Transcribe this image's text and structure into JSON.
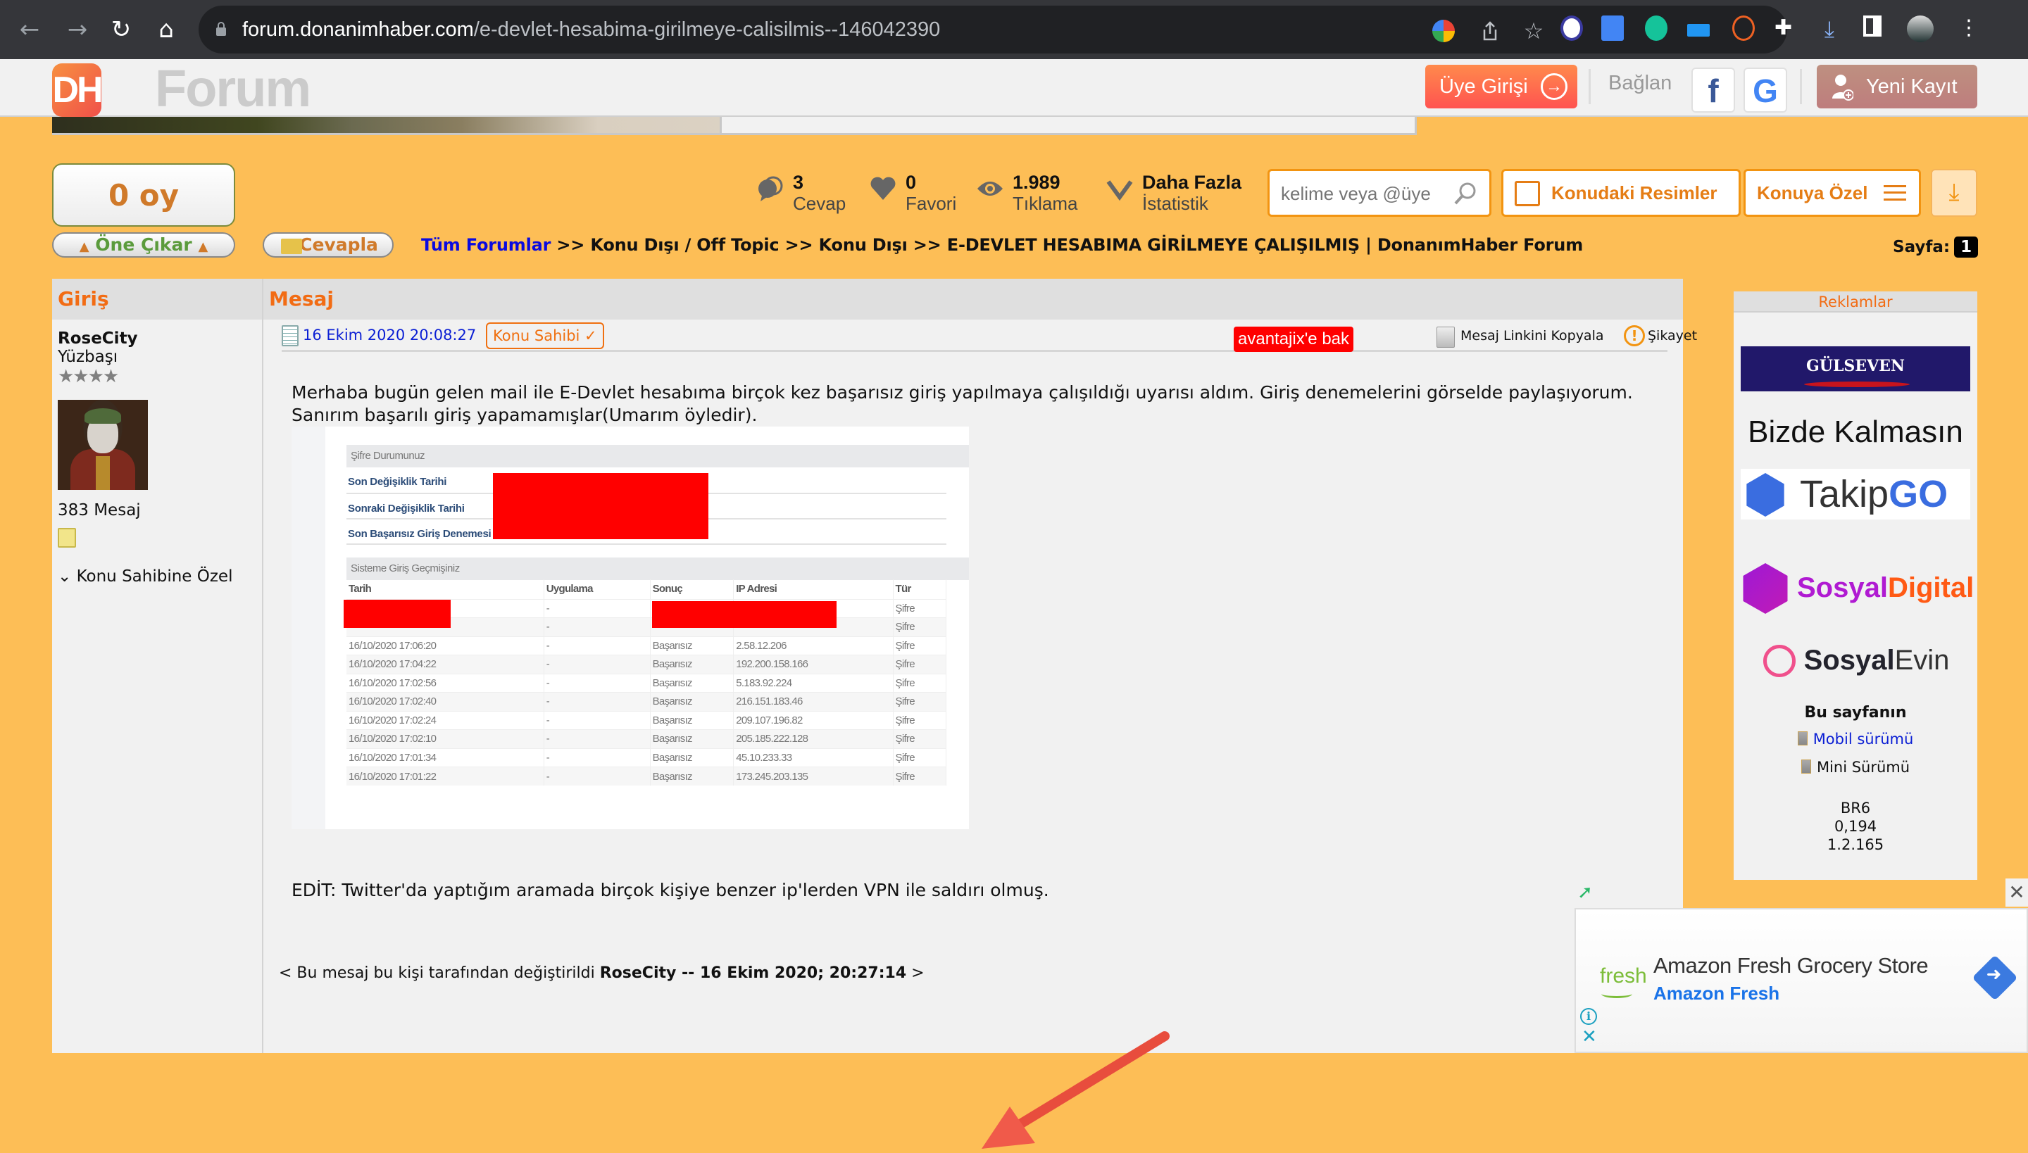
{
  "browser": {
    "url_host": "forum.donanimhaber.com",
    "url_path": "/e-devlet-hesabima-girilmeye-calisilmis--146042390",
    "nav": {
      "back": "←",
      "forward": "→",
      "reload": "↻",
      "home": "⌂"
    },
    "toolbar_icons": [
      "google-icon",
      "share-icon",
      "bookmark-star-icon",
      "adblock-icon",
      "google-translate-icon",
      "grammarly-icon",
      "screen-icon",
      "bitly-icon",
      "extensions-puzzle-icon",
      "download-icon",
      "sidepanel-icon",
      "profile-avatar",
      "menu-kebab-icon"
    ]
  },
  "site": {
    "logo_dh": "DH",
    "logo_forum": "Forum",
    "login_label": "Üye Girişi",
    "connect_label": "Bağlan",
    "facebook": "f",
    "google": "G",
    "register_label": "Yeni Kayıt"
  },
  "toolbar": {
    "vote": "0 oy",
    "promote": "Öne Çıkar",
    "reply": "Cevapla",
    "stats": [
      {
        "value": "3",
        "label": "Cevap",
        "icon": "chat-bubbles-icon"
      },
      {
        "value": "0",
        "label": "Favori",
        "icon": "heart-icon"
      },
      {
        "value": "1.989",
        "label": "Tıklama",
        "icon": "eye-icon"
      },
      {
        "value": "Daha Fazla",
        "label": "İstatistik",
        "icon": "chevron-down-icon"
      }
    ],
    "search_placeholder": "kelime veya @üye",
    "images_button": "Konudaki Resimler",
    "topic_special_button": "Konuya Özel"
  },
  "breadcrumb": {
    "root": "Tüm Forumlar",
    "rest": " >> Konu Dışı / Off Topic >> Konu Dışı >> E-DEVLET HESABIMA GİRİLMEYE ÇALIŞILMIŞ | DonanımHaber Forum"
  },
  "pagination": {
    "label": "Sayfa:",
    "current": "1"
  },
  "post": {
    "col_user": "Giriş",
    "col_message": "Mesaj",
    "user": {
      "name": "RoseCity",
      "rank": "Yüzbaşı",
      "stars": "★★★★",
      "posts": "383 Mesaj",
      "owner_special": "Konu Sahibine Özel"
    },
    "date": "16 Ekim 2020 20:08:27",
    "owner_badge": "Konu Sahibi ✓",
    "avantajix": "avantajix'e bak",
    "copy_link": "Mesaj Linkini Kopyala",
    "report": "Şikayet",
    "body": "Merhaba bugün gelen mail ile E-Devlet hesabıma birçok kez başarısız giriş yapılmaya çalışıldığı uyarısı aldım. Giriş denemelerini görselde paylaşıyorum. Sanırım başarılı giriş yapamamışlar(Umarım öyledir).",
    "edit_text": "EDİT: Twitter'da yaptığım aramada birçok kişiye benzer ip'lerden VPN ile saldırı olmuş.",
    "edited_prefix": "< Bu mesaj bu kişi tarafından değiştirildi ",
    "edited_user": "RoseCity",
    "edited_date": " -- 16 Ekim 2020; 20:27:14",
    "edited_suffix": " >"
  },
  "screenshot": {
    "section1": "Şifre Durumunuz",
    "labels": [
      "Son Değişiklik Tarihi",
      "Sonraki Değişiklik Tarihi",
      "Son Başarısız Giriş Denemesi"
    ],
    "section2": "Sisteme Giriş Geçmişiniz",
    "columns": [
      "Tarih",
      "Uygulama",
      "Sonuç",
      "IP Adresi",
      "Tür"
    ],
    "rows": [
      [
        "",
        "-",
        "",
        "",
        "Şifre"
      ],
      [
        "",
        "-",
        "",
        "",
        "Şifre"
      ],
      [
        "16/10/2020 17:06:20",
        "-",
        "Başarısız",
        "2.58.12.206",
        "Şifre"
      ],
      [
        "16/10/2020 17:04:22",
        "-",
        "Başarısız",
        "192.200.158.166",
        "Şifre"
      ],
      [
        "16/10/2020 17:02:56",
        "-",
        "Başarısız",
        "5.183.92.224",
        "Şifre"
      ],
      [
        "16/10/2020 17:02:40",
        "-",
        "Başarısız",
        "216.151.183.46",
        "Şifre"
      ],
      [
        "16/10/2020 17:02:24",
        "-",
        "Başarısız",
        "209.107.196.82",
        "Şifre"
      ],
      [
        "16/10/2020 17:02:10",
        "-",
        "Başarısız",
        "205.185.222.128",
        "Şifre"
      ],
      [
        "16/10/2020 17:01:34",
        "-",
        "Başarısız",
        "45.10.233.33",
        "Şifre"
      ],
      [
        "16/10/2020 17:01:22",
        "-",
        "Başarısız",
        "173.245.203.135",
        "Şifre"
      ]
    ]
  },
  "sidebar": {
    "header": "Reklamlar",
    "ads": [
      "GÜLSEVEN",
      "Bizde Kalmasın",
      "Takip",
      "GO",
      "Sosyal",
      "Digital",
      "Sosyal",
      "Evin"
    ],
    "page_versions_title": "Bu sayfanın",
    "mobile_link": "Mobil sürümü",
    "mini_link": "Mini Sürümü",
    "info": [
      "BR6",
      "0,194",
      "1.2.165"
    ]
  },
  "float_ad": {
    "brand": "fresh",
    "title": "Amazon Fresh Grocery Store",
    "subtitle": "Amazon Fresh",
    "close": "✕",
    "info": "i",
    "x": "✕"
  }
}
